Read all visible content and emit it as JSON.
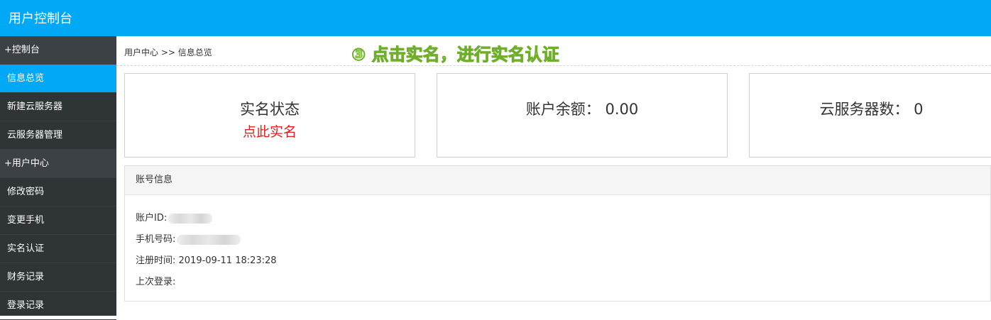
{
  "header": {
    "title": "用户控制台"
  },
  "sidebar": {
    "items": [
      {
        "label": "+控制台",
        "type": "group"
      },
      {
        "label": "信息总览",
        "type": "item",
        "active": true
      },
      {
        "label": "新建云服务器",
        "type": "item"
      },
      {
        "label": "云服务器管理",
        "type": "item"
      },
      {
        "label": "+用户中心",
        "type": "group"
      },
      {
        "label": "修改密码",
        "type": "item"
      },
      {
        "label": "变更手机",
        "type": "item"
      },
      {
        "label": "实名认证",
        "type": "item"
      },
      {
        "label": "财务记录",
        "type": "item"
      },
      {
        "label": "登录记录",
        "type": "item"
      }
    ]
  },
  "breadcrumb": {
    "text": "用户中心 >> 信息总览"
  },
  "annotation": {
    "text": "③ 点击实名，进行实名认证",
    "color": "#9fdf5a"
  },
  "cards": {
    "realname": {
      "title": "实名状态",
      "link": "点此实名"
    },
    "balance": {
      "text": "账户余额： 0.00"
    },
    "servers": {
      "text": "云服务器数： 0"
    }
  },
  "account_panel": {
    "title": "账号信息",
    "account_id_label": "账户ID:",
    "phone_label": "手机号码:",
    "register_time": "注册时间: 2019-09-11 18:23:28",
    "last_login_label": "上次登录:"
  },
  "colors": {
    "topbar": "#00a8f5",
    "sidebar": "#2f3437",
    "active": "#00a8f5",
    "link_red": "#e02020"
  }
}
